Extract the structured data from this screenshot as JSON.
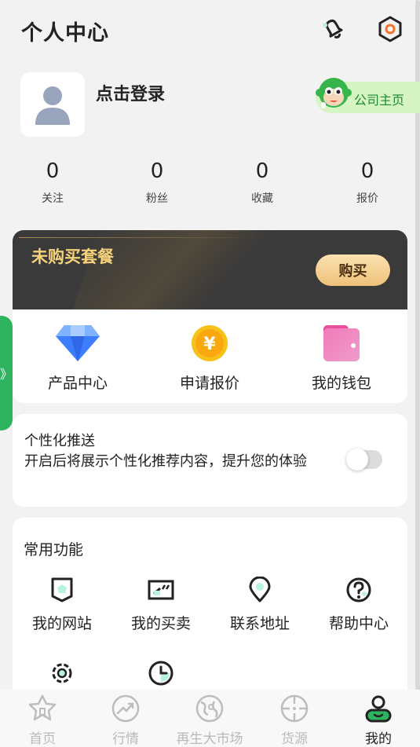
{
  "header": {
    "title": "个人中心"
  },
  "profile": {
    "login": "点击登录",
    "company_home": "公司主页"
  },
  "stats": [
    {
      "value": "0",
      "label": "关注"
    },
    {
      "value": "0",
      "label": "粉丝"
    },
    {
      "value": "0",
      "label": "收藏"
    },
    {
      "value": "0",
      "label": "报价"
    }
  ],
  "package": {
    "title": "未购买套餐",
    "buy": "购买",
    "items": [
      {
        "label": "产品中心",
        "icon": "diamond-icon"
      },
      {
        "label": "申请报价",
        "icon": "yen-coin-icon"
      },
      {
        "label": "我的钱包",
        "icon": "wallet-icon"
      }
    ]
  },
  "side_tab": {
    "label": "》"
  },
  "personalization": {
    "title": "个性化推送",
    "desc": "开启后将展示个性化推荐内容，提升您的体验",
    "enabled": false
  },
  "functions": {
    "title": "常用功能",
    "items": [
      {
        "label": "我的网站",
        "icon": "website-icon"
      },
      {
        "label": "我的买卖",
        "icon": "trade-icon"
      },
      {
        "label": "联系地址",
        "icon": "location-icon"
      },
      {
        "label": "帮助中心",
        "icon": "help-icon"
      },
      {
        "label": "",
        "icon": "settings-icon"
      },
      {
        "label": "",
        "icon": "clock-icon"
      }
    ]
  },
  "nav": [
    {
      "label": "首页",
      "icon": "home-icon",
      "active": false
    },
    {
      "label": "行情",
      "icon": "trend-icon",
      "active": false
    },
    {
      "label": "再生大市场",
      "icon": "market-globe-icon",
      "active": false
    },
    {
      "label": "货源",
      "icon": "target-icon",
      "active": false
    },
    {
      "label": "我的",
      "icon": "profile-icon",
      "active": true
    }
  ],
  "colors": {
    "accent": "#2eb35f",
    "gold": "#f6d27a",
    "mint": "#b9f3dd"
  }
}
